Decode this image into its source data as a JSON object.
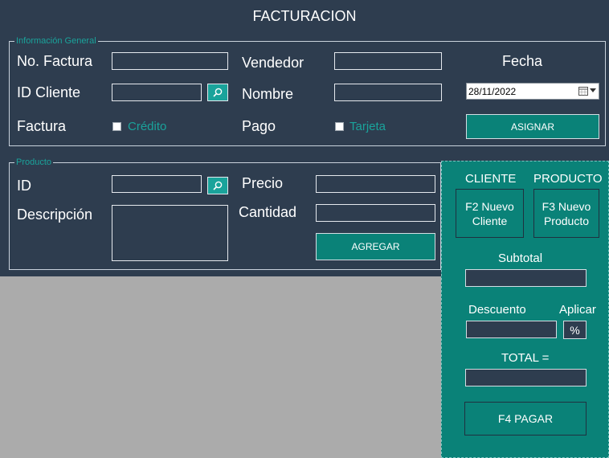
{
  "window": {
    "title": "FACTURACION"
  },
  "info_general": {
    "legend": "Información General",
    "no_factura_label": "No. Factura",
    "id_cliente_label": "ID Cliente",
    "factura_label": "Factura",
    "credito_label": "Crédito",
    "vendedor_label": "Vendedor",
    "nombre_label": "Nombre",
    "pago_label": "Pago",
    "tarjeta_label": "Tarjeta",
    "fecha_label": "Fecha",
    "fecha_value": "28/11/2022",
    "asignar_label": "ASIGNAR"
  },
  "producto": {
    "legend": "Producto",
    "id_label": "ID",
    "descripcion_label": "Descripción",
    "precio_label": "Precio",
    "cantidad_label": "Cantidad",
    "agregar_label": "AGREGAR"
  },
  "side": {
    "cliente_label": "CLIENTE",
    "producto_label": "PRODUCTO",
    "nuevo_cliente_label": "F2 Nuevo Cliente",
    "nuevo_producto_label": "F3 Nuevo Producto",
    "subtotal_label": "Subtotal",
    "descuento_label": "Descuento",
    "aplicar_label": "Aplicar",
    "pct_label": "%",
    "total_label": "TOTAL =",
    "pagar_label": "F4 PAGAR"
  },
  "colors": {
    "background": "#2e3d4f",
    "accent": "#0a8278",
    "legend_text": "#1aa39b",
    "grid_area": "#ababab"
  }
}
